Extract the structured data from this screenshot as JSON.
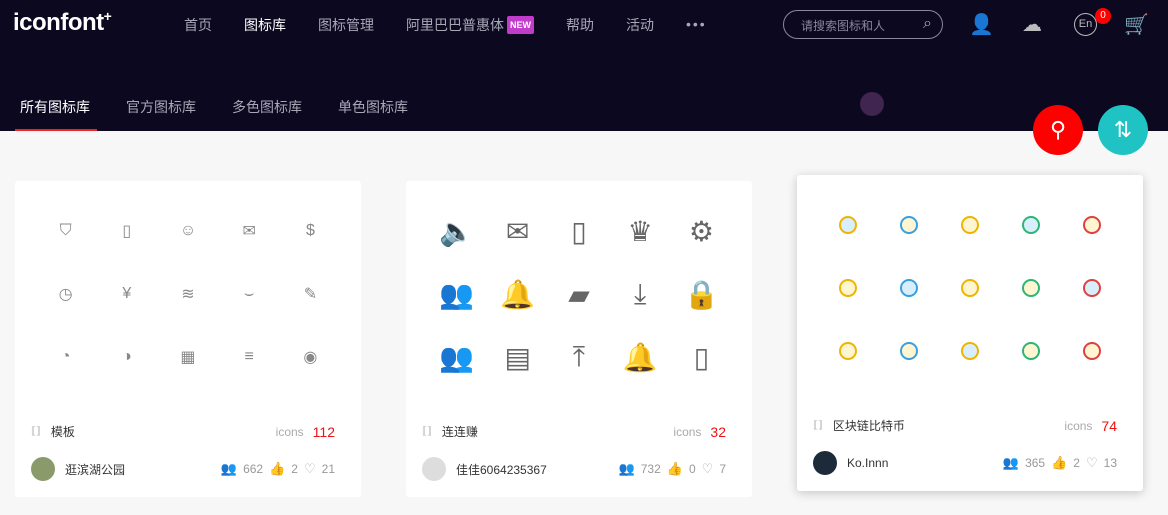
{
  "header": {
    "logo": "iconfont",
    "logo_plus": "+",
    "nav": [
      "首页",
      "图标库",
      "图标管理",
      "阿里巴巴普惠体",
      "帮助",
      "活动"
    ],
    "new_badge": "NEW",
    "more": "•••",
    "search_placeholder": "请搜索图标和人",
    "lang": "En",
    "cart_count": "0"
  },
  "tabs": [
    "所有图标库",
    "官方图标库",
    "多色图标库",
    "单色图标库"
  ],
  "colors": {
    "header_bg": "#0b0820",
    "accent": "#ff0000",
    "teal": "#1fc3c3"
  },
  "cards": [
    {
      "title": "模板",
      "icons_label": "icons",
      "count": "112",
      "user": "逛滨湖公园",
      "views": "662",
      "likes": "2",
      "favs": "21",
      "glyphs": [
        "⛉",
        "▯",
        "☺",
        "✉",
        "$",
        "◷",
        "¥",
        "≋",
        "⌣",
        "✎",
        "◔",
        "◑",
        "▦",
        "≡",
        "◉"
      ]
    },
    {
      "title": "连连赚",
      "icons_label": "icons",
      "count": "32",
      "user": "佳佳6064235367",
      "views": "732",
      "likes": "0",
      "favs": "7",
      "glyphs": [
        "🔈",
        "✉",
        "▯",
        "♛",
        "⚙",
        "👥",
        "🔔",
        "▰",
        "⤓",
        "🔒",
        "👥",
        "▤",
        "⤒",
        "🔔",
        "▯"
      ]
    },
    {
      "title": "区块链比特币",
      "icons_label": "icons",
      "count": "74",
      "user": "Ko.Innn",
      "views": "365",
      "likes": "2",
      "favs": "13"
    }
  ]
}
